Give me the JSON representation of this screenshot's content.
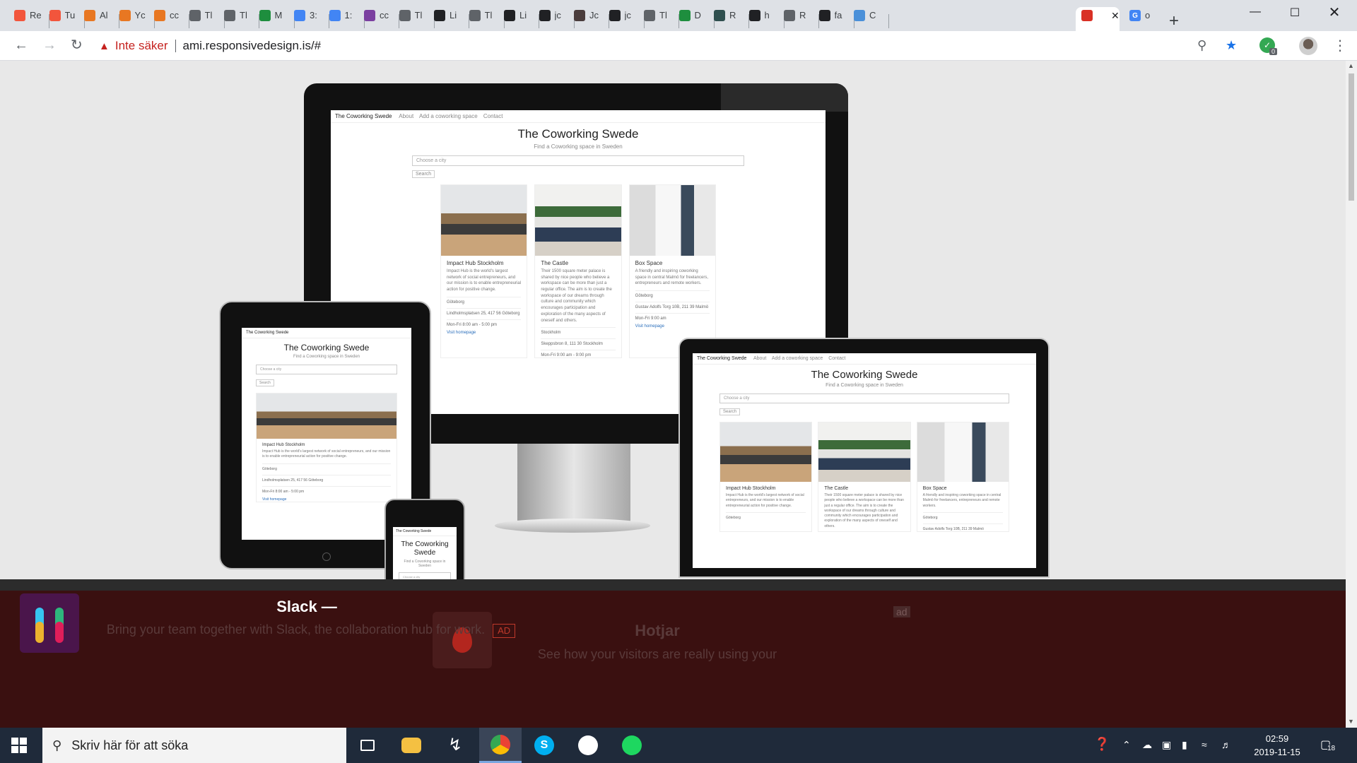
{
  "browser": {
    "tabs": [
      {
        "title": "Re",
        "color": "#f2553c"
      },
      {
        "title": "Tu",
        "color": "#f2553c"
      },
      {
        "title": "Al",
        "color": "#e87722"
      },
      {
        "title": "Yc",
        "color": "#e87722"
      },
      {
        "title": "cc",
        "color": "#e87722"
      },
      {
        "title": "Tl",
        "color": "#5f6368"
      },
      {
        "title": "Tl",
        "color": "#5f6368"
      },
      {
        "title": "M",
        "color": "#1e8e3e"
      },
      {
        "title": "3:",
        "color": "#4285f4"
      },
      {
        "title": "1:",
        "color": "#4285f4"
      },
      {
        "title": "cc",
        "color": "#7b3fa0"
      },
      {
        "title": "Tl",
        "color": "#5f6368"
      },
      {
        "title": "Li",
        "color": "#202124"
      },
      {
        "title": "Tl",
        "color": "#5f6368"
      },
      {
        "title": "Li",
        "color": "#202124"
      },
      {
        "title": "jc",
        "color": "#202124"
      },
      {
        "title": "Jc",
        "color": "#4a3c3c"
      },
      {
        "title": "jc",
        "color": "#202124"
      },
      {
        "title": "Tl",
        "color": "#5f6368"
      },
      {
        "title": "D",
        "color": "#1e8e3e"
      },
      {
        "title": "R",
        "color": "#2f4f4f"
      },
      {
        "title": "h",
        "color": "#202124"
      },
      {
        "title": "R",
        "color": "#5f6368"
      },
      {
        "title": "fa",
        "color": "#202124"
      },
      {
        "title": "C",
        "color": "#4a90d9"
      }
    ],
    "active_tab": {
      "title": "",
      "color": "#d93025"
    },
    "last_tab": {
      "title": "o",
      "color": "#4285f4"
    },
    "new_tab": "+",
    "security_label": "Inte säker",
    "url": "ami.responsivedesign.is/#",
    "extension_badge": "0"
  },
  "site": {
    "brand": "The Coworking Swede",
    "nav": [
      "About",
      "Add a coworking space",
      "Contact"
    ],
    "title": "The Coworking Swede",
    "subtitle": "Find a Coworking space in Sweden",
    "select_placeholder": "Choose a city",
    "search_button": "Search",
    "cards": [
      {
        "name": "Impact Hub Stockholm",
        "desc": "Impact Hub is the world's largest network of social entrepreneurs, and our mission is to enable entrepreneurial action for positive change.",
        "city": "Göteborg",
        "address": "Lindholmsplatsen 25, 417 56 Göteborg",
        "hours": "Mon-Fri 8:00 am - 5:00 pm",
        "link": "Visit homepage"
      },
      {
        "name": "The Castle",
        "desc": "Their 1500 square meter palace is shared by nice people who believe a workspace can be more than just a regular office. The aim is to create the workspace of our dreams through culture and community which encourages participation and exploration of the many aspects of oneself and others.",
        "city": "Stockholm",
        "address": "Skeppsbron 8, 111 30 Stockholm",
        "hours": "Mon-Fri 9:00 am - 9:00 pm",
        "link": ""
      },
      {
        "name": "Box Space",
        "desc": "A friendly and inspiring coworking space in central Malmö for freelancers, entrepreneurs and remote workers.",
        "city": "Göteborg",
        "address": "Gustav Adolfs Torg 10B, 211 39 Malmö",
        "hours": "Mon-Fri 9:00 am",
        "link": "Visit homepage"
      }
    ],
    "phone_title": "The Coworking Swede"
  },
  "ad": {
    "slack_title": "Slack —",
    "slack_text": "Bring your team together with Slack, the collaboration hub for work.",
    "ad_tag": "AD",
    "hotjar_title": "Hotjar",
    "hotjar_text": "See how your visitors are really using your",
    "badge": "ad"
  },
  "taskbar": {
    "search_placeholder": "Skriv här för att söka",
    "time": "02:59",
    "date": "2019-11-15",
    "notifications": "18"
  }
}
